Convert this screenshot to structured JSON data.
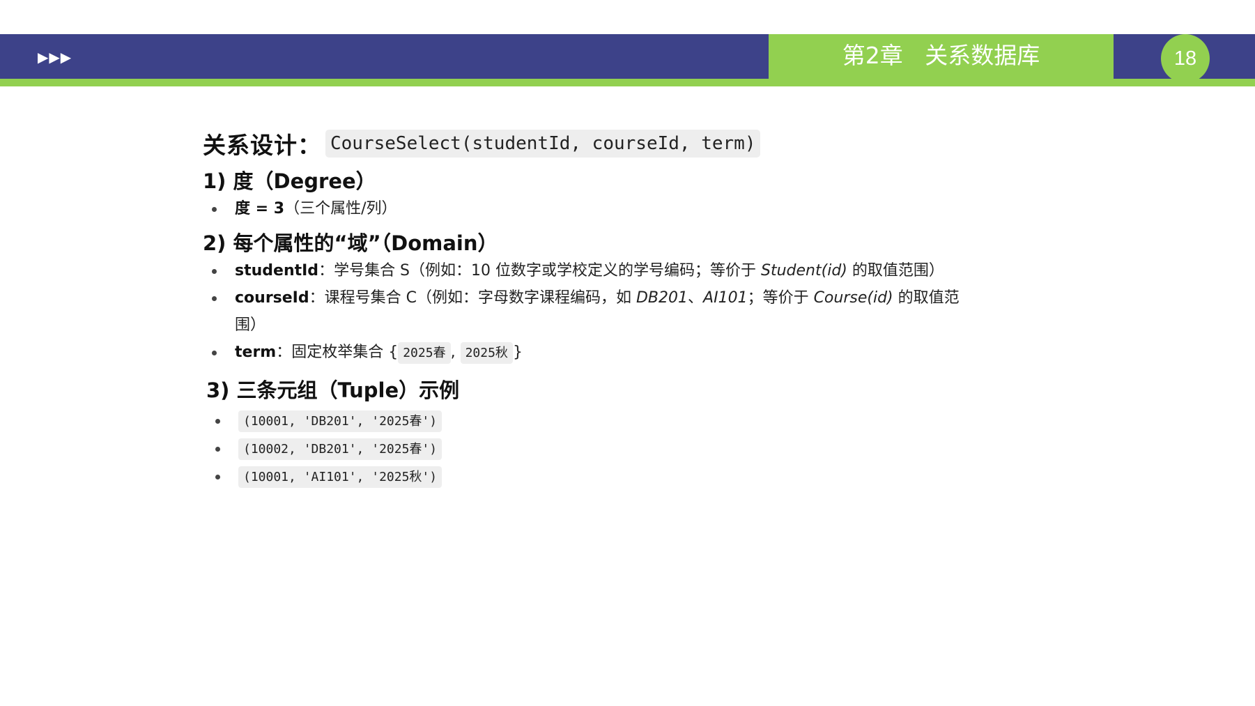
{
  "header": {
    "arrows": "▶▶▶",
    "chapter_title": "第2章   关系数据库",
    "page_number": "18",
    "colors": {
      "navy": "#3d4289",
      "green": "#92d050"
    }
  },
  "content": {
    "title_label": "关系设计：",
    "title_code": "CourseSelect(studentId, courseId, term)",
    "section1": {
      "heading": "1) 度（Degree）",
      "items": [
        {
          "bold": "度 = 3",
          "text": "（三个属性/列）"
        }
      ]
    },
    "section2": {
      "heading": "2) 每个属性的“域”（Domain）",
      "student": {
        "bold": "studentId",
        "text1": "：学号集合 S（例如：10 位数字或学校定义的学号编码；等价于 ",
        "italic": "Student(id)",
        "text2": " 的取值范围）"
      },
      "course": {
        "bold": "courseId",
        "text1": "：课程号集合 C（例如：字母数字课程编码，如 ",
        "italic1": "DB201",
        "sep": "、",
        "italic2": "AI101",
        "text2": "；等价于 ",
        "italic3": "Course(id)",
        "text3": " 的取值范围）"
      },
      "term": {
        "bold": "term",
        "text1": "：固定枚举集合 {",
        "code1": "2025春",
        "comma": ", ",
        "code2": "2025秋",
        "text2": "}"
      }
    },
    "section3": {
      "heading": "3) 三条元组（Tuple）示例",
      "tuples": [
        "(10001, 'DB201', '2025春')",
        "(10002, 'DB201', '2025春')",
        "(10001, 'AI101', '2025秋')"
      ]
    }
  }
}
